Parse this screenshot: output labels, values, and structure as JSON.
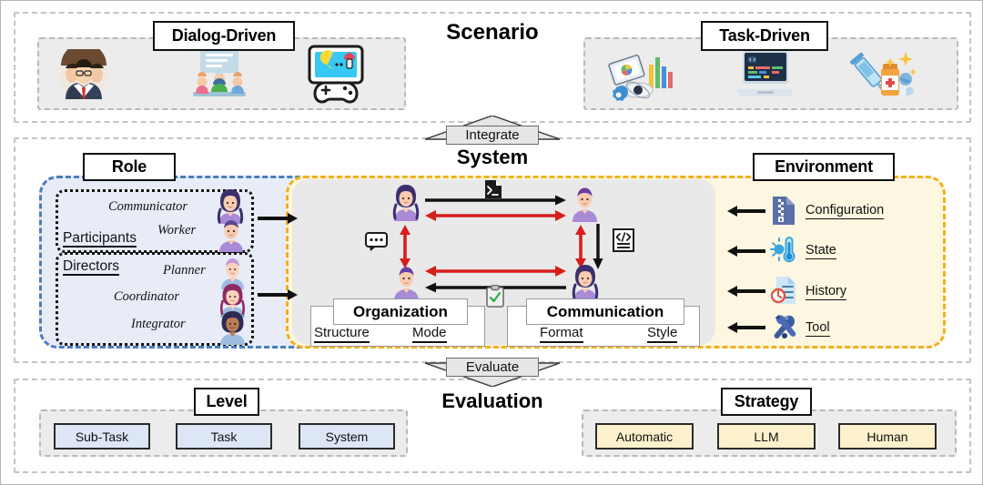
{
  "sections": {
    "scenario": {
      "title": "Scenario",
      "groups": [
        {
          "label": "Dialog-Driven",
          "icons": [
            "business-people-icon",
            "chat-meeting-icon",
            "game-console-icon"
          ]
        },
        {
          "label": "Task-Driven",
          "icons": [
            "data-analysis-icon",
            "code-laptop-icon",
            "medical-syringe-icon"
          ]
        }
      ]
    },
    "system": {
      "title": "System",
      "role": {
        "label": "Role",
        "subgroups": [
          {
            "heading": "Participants",
            "items": [
              "Communicator",
              "Worker"
            ],
            "avatars": [
              "avatar-female-purple",
              "avatar-male-blue"
            ]
          },
          {
            "heading": "Directors",
            "items": [
              "Planner",
              "Coordinator",
              "Integrator"
            ],
            "avatars": [
              "avatar-male-pink",
              "avatar-female-magenta",
              "avatar-female-dark"
            ]
          }
        ]
      },
      "core": {
        "agents": [
          "agent-top-left",
          "agent-top-right",
          "agent-bottom-left",
          "agent-bottom-right"
        ],
        "icons": [
          "terminal-script-icon",
          "speech-bubble-icon",
          "code-document-icon",
          "clipboard-check-icon"
        ],
        "boxes": [
          {
            "title": "Organization",
            "words": [
              "Structure",
              "Mode"
            ]
          },
          {
            "title": "Communication",
            "words": [
              "Format",
              "Style"
            ]
          }
        ]
      },
      "environment": {
        "label": "Environment",
        "items": [
          {
            "name": "Configuration",
            "icon": "zip-file-icon"
          },
          {
            "name": "State",
            "icon": "thermometer-sun-icon"
          },
          {
            "name": "History",
            "icon": "clock-document-icon"
          },
          {
            "name": "Tool",
            "icon": "wrench-tools-icon"
          }
        ]
      }
    },
    "evaluation": {
      "title": "Evaluation",
      "groups": [
        {
          "label": "Level",
          "items": [
            "Sub-Task",
            "Task",
            "System"
          ],
          "style": "blue"
        },
        {
          "label": "Strategy",
          "items": [
            "Automatic",
            "LLM",
            "Human"
          ],
          "style": "yellow"
        }
      ]
    }
  },
  "connectors": {
    "integrate": "Integrate",
    "evaluate": "Evaluate"
  },
  "colors": {
    "role_border": "#4a7ebb",
    "role_fill": "#e8ecf7",
    "env_border": "#f2b01e",
    "env_fill": "#fdf6e0",
    "core_fill": "#e9e9e9",
    "panel_border": "#c4c4c4",
    "group_fill": "#ececec",
    "red_arrow": "#d81d1d",
    "black_arrow": "#111111",
    "eval_blue": "#dde6f5",
    "eval_yellow": "#fdf1cd"
  }
}
